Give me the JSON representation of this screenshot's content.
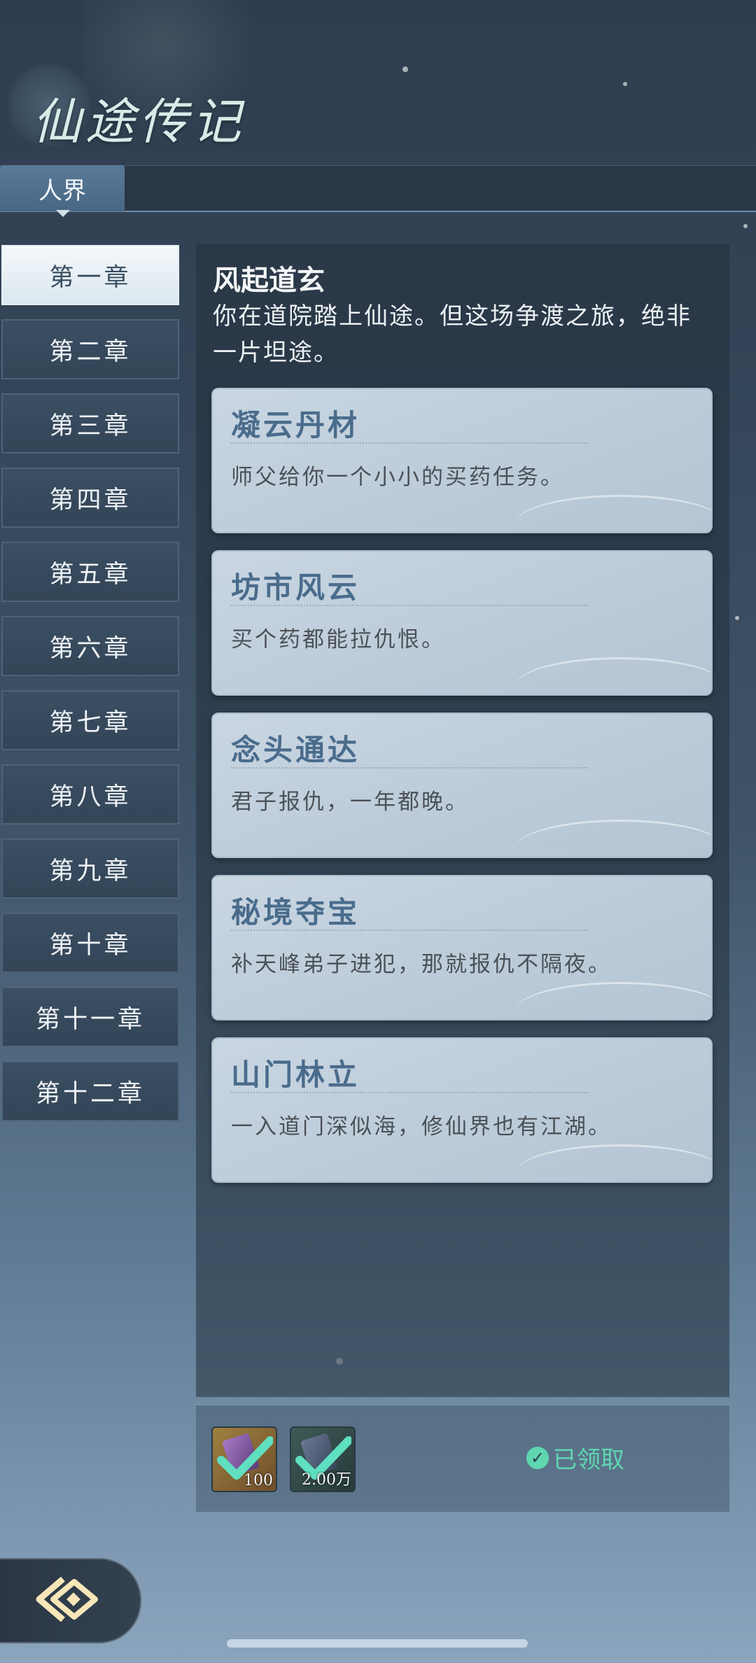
{
  "header": {
    "title": "仙途传记"
  },
  "tabs": [
    {
      "label": "人界",
      "active": true
    }
  ],
  "chapters": [
    {
      "label": "第一章",
      "active": true
    },
    {
      "label": "第二章"
    },
    {
      "label": "第三章"
    },
    {
      "label": "第四章"
    },
    {
      "label": "第五章"
    },
    {
      "label": "第六章"
    },
    {
      "label": "第七章"
    },
    {
      "label": "第八章"
    },
    {
      "label": "第九章"
    },
    {
      "label": "第十章"
    },
    {
      "label": "第十一章"
    },
    {
      "label": "第十二章"
    }
  ],
  "chapter_detail": {
    "title": "风起道玄",
    "description": "你在道院踏上仙途。但这场争渡之旅，绝非一片坦途。"
  },
  "quests": [
    {
      "name": "凝云丹材",
      "text": "师父给你一个小小的买药任务。"
    },
    {
      "name": "坊市风云",
      "text": "买个药都能拉仇恨。"
    },
    {
      "name": "念头通达",
      "text": "君子报仇，一年都晚。"
    },
    {
      "name": "秘境夺宝",
      "text": "补天峰弟子进犯，那就报仇不隔夜。"
    },
    {
      "name": "山门林立",
      "text": "一入道门深似海，修仙界也有江湖。"
    }
  ],
  "rewards": {
    "items": [
      {
        "count": "100",
        "icon": "purple-crystal-icon",
        "claimed": true
      },
      {
        "count": "2.00万",
        "icon": "spirit-stone-icon",
        "claimed": true
      }
    ],
    "status_label": "已领取"
  },
  "colors": {
    "accent": "#5fd6b0",
    "quest_title": "#4a6c8c"
  }
}
